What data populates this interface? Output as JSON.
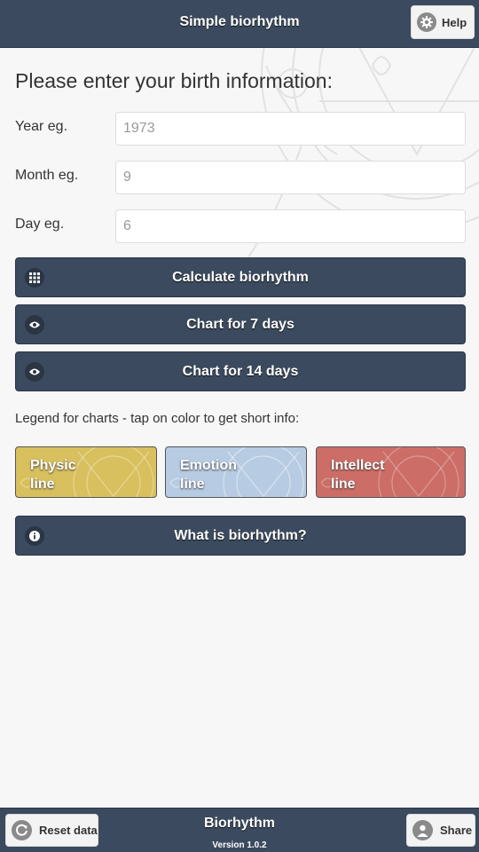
{
  "header": {
    "title": "Simple biorhythm",
    "help_label": "Help"
  },
  "form": {
    "title": "Please enter your birth information:",
    "fields": [
      {
        "label": "Year eg.",
        "placeholder": "1973",
        "value": ""
      },
      {
        "label": "Month eg.",
        "placeholder": "9",
        "value": ""
      },
      {
        "label": "Day eg.",
        "placeholder": "6",
        "value": ""
      }
    ]
  },
  "buttons": {
    "calculate": "Calculate biorhythm",
    "chart7": "Chart for 7 days",
    "chart14": "Chart for 14 days",
    "what_is": "What is biorhythm?"
  },
  "legend": {
    "caption": "Legend for charts - tap on color to get short info:",
    "items": [
      {
        "line1": "Physic",
        "line2": "line",
        "color": "#d9c05e"
      },
      {
        "line1": "Emotion",
        "line2": "line",
        "color": "#b7cce3"
      },
      {
        "line1": "Intellect",
        "line2": "line",
        "color": "#cc6e67"
      }
    ]
  },
  "footer": {
    "title": "Biorhythm",
    "version": "Version 1.0.2",
    "reset_label": "Reset data",
    "share_label": "Share"
  },
  "icons": {
    "help": "gear-icon",
    "calculate": "grid-icon",
    "chart7": "eye-icon",
    "chart14": "eye-icon",
    "what_is": "info-icon",
    "reset": "refresh-icon",
    "share": "user-icon"
  },
  "colors": {
    "bar": "#3b4a5e",
    "background": "#f7f7f7"
  }
}
